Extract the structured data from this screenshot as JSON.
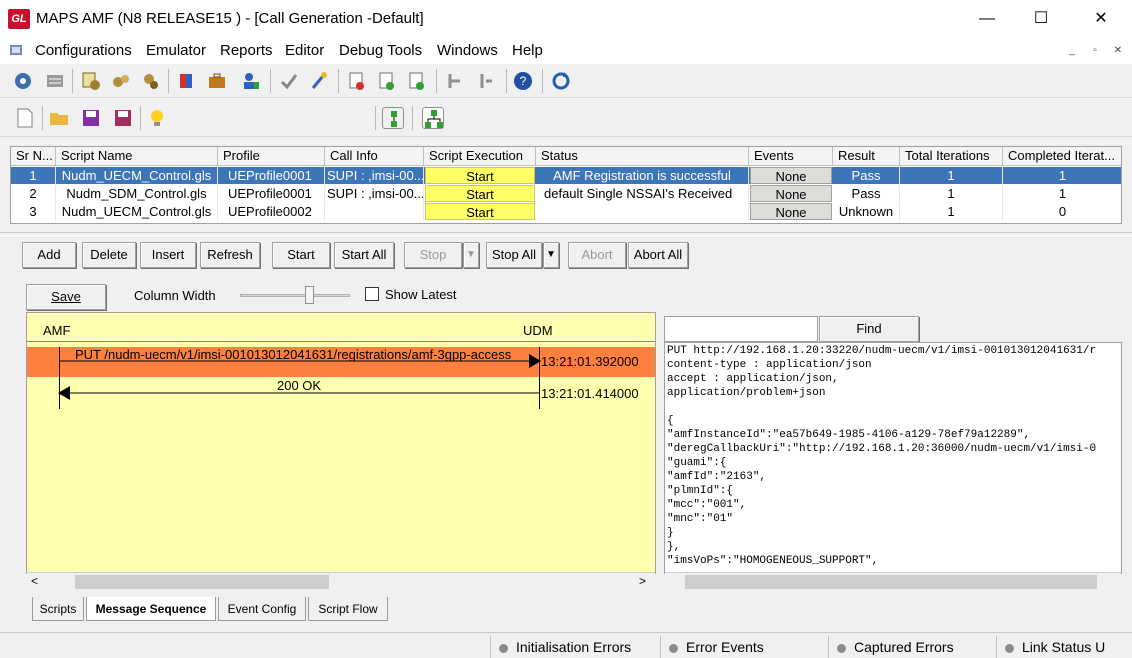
{
  "window": {
    "logo_text": "GL",
    "title": "MAPS AMF (N8 RELEASE15 ) - [Call Generation  -Default]",
    "minimize": "—",
    "maximize": "☐",
    "close": "✕"
  },
  "menu": [
    "Configurations",
    "Emulator",
    "Reports",
    "Editor",
    "Debug Tools",
    "Windows",
    "Help"
  ],
  "mdi_controls": [
    "_",
    "▫",
    "✕"
  ],
  "table": {
    "headers": [
      "Sr N...",
      "Script Name",
      "Profile",
      "Call Info",
      "Script Execution",
      "Status",
      "Events",
      "Result",
      "Total Iterations",
      "Completed Iterat..."
    ],
    "rows": [
      {
        "sr": "1",
        "script": "Nudm_UECM_Control.gls",
        "profile": "UEProfile0001",
        "callinfo": "SUPI : ,imsi-00...",
        "exec": "Start",
        "status": "AMF Registration is successful",
        "events": "None",
        "result": "Pass",
        "total": "1",
        "completed": "1"
      },
      {
        "sr": "2",
        "script": "Nudm_SDM_Control.gls",
        "profile": "UEProfile0001",
        "callinfo": "SUPI : ,imsi-00...",
        "exec": "Start",
        "status": "default Single NSSAI's Received",
        "events": "None",
        "result": "Pass",
        "total": "1",
        "completed": "1"
      },
      {
        "sr": "3",
        "script": "Nudm_UECM_Control.gls",
        "profile": "UEProfile0002",
        "callinfo": "",
        "exec": "Start",
        "status": "",
        "events": "None",
        "result": "Unknown",
        "total": "1",
        "completed": "0"
      }
    ]
  },
  "buttons": {
    "add": "Add",
    "delete": "Delete",
    "insert": "Insert",
    "refresh": "Refresh",
    "start": "Start",
    "start_all": "Start All",
    "stop": "Stop",
    "stop_all": "Stop All",
    "abort": "Abort",
    "abort_all": "Abort All",
    "dropdown_arrow": "▼"
  },
  "seq_controls": {
    "save": "Save",
    "column_width": "Column Width",
    "show_latest": "Show Latest"
  },
  "sequence": {
    "left_entity": "AMF",
    "right_entity": "UDM",
    "messages": [
      {
        "label": "PUT /nudm-uecm/v1/imsi-001013012041631/registrations/amf-3gpp-access",
        "time": "13:21:01.392000"
      },
      {
        "label": "200 OK",
        "time": "13:21:01.414000"
      }
    ]
  },
  "find": {
    "button": "Find"
  },
  "message_text": "PUT http://192.168.1.20:33220/nudm-uecm/v1/imsi-001013012041631/r\ncontent-type : application/json\naccept : application/json,\napplication/problem+json\n\n{\n\"amfInstanceId\":\"ea57b649-1985-4106-a129-78ef79a12289\",\n\"deregCallbackUri\":\"http://192.168.1.20:36000/nudm-uecm/v1/imsi-0\n\"guami\":{\n\"amfId\":\"2163\",\n\"plmnId\":{\n\"mcc\":\"001\",\n\"mnc\":\"01\"\n}\n},\n\"imsVoPs\":\"HOMOGENEOUS_SUPPORT\",",
  "scroll": {
    "left": "<",
    "right": ">"
  },
  "tabs": [
    "Scripts",
    "Message Sequence",
    "Event Config",
    "Script Flow"
  ],
  "status_bar": [
    "Initialisation Errors",
    "Error Events",
    "Captured Errors",
    "Link Status U"
  ],
  "colors": {
    "selected_row": "#3c76b8",
    "start_cell": "#ffff66",
    "sequence_bg": "#ffffb0",
    "message_highlight": "#ff7f3f"
  }
}
